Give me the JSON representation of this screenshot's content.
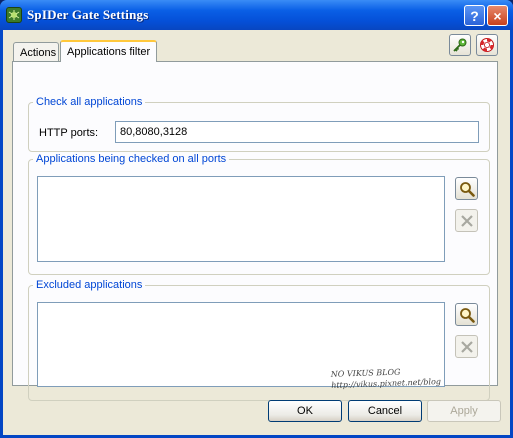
{
  "window": {
    "title": "SpIDer Gate Settings",
    "help_glyph": "?",
    "close_glyph": "×"
  },
  "tabs": [
    {
      "label": "Actions",
      "active": false
    },
    {
      "label": "Applications filter",
      "active": true
    }
  ],
  "check_all": {
    "title": "Check all applications",
    "http_label": "HTTP ports:",
    "http_value": "80,8080,3128"
  },
  "checked_all_ports": {
    "title": "Applications being checked on all ports",
    "items": []
  },
  "excluded": {
    "title": "Excluded applications",
    "items": []
  },
  "watermark": {
    "line1": "NO VIKUS BLOG",
    "line2": "http://vikus.pixnet.net/blog"
  },
  "footer": {
    "ok": "OK",
    "cancel": "Cancel",
    "apply": "Apply"
  },
  "icons": {
    "app": "spider-icon",
    "key": "key-icon",
    "lifebuoy": "lifebuoy-icon",
    "browse": "magnifier-icon",
    "remove": "cross-icon"
  },
  "colors": {
    "group_title": "#0046d5",
    "titlebar": "#0550d8",
    "tab_highlight": "#ffc83c"
  }
}
